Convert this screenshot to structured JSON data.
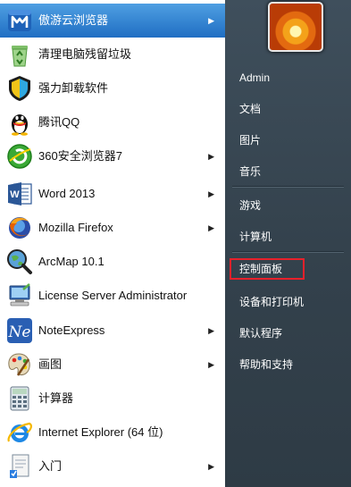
{
  "programs": [
    {
      "label": "傲游云浏览器",
      "icon": "maxthon-icon",
      "has_arrow": true,
      "selected": true
    },
    {
      "label": "清理电脑残留垃圾",
      "icon": "recycle-bin-icon",
      "has_arrow": false
    },
    {
      "label": "强力卸载软件",
      "icon": "uninstaller-icon",
      "has_arrow": false
    },
    {
      "label": "腾讯QQ",
      "icon": "qq-penguin-icon",
      "has_arrow": false
    },
    {
      "label": "360安全浏览器7",
      "icon": "360-browser-icon",
      "has_arrow": true
    },
    {
      "label": "Word 2013",
      "icon": "word-icon",
      "has_arrow": true
    },
    {
      "label": "Mozilla Firefox",
      "icon": "firefox-icon",
      "has_arrow": true
    },
    {
      "label": "ArcMap 10.1",
      "icon": "arcmap-icon",
      "has_arrow": false
    },
    {
      "label": "License Server Administrator",
      "icon": "license-server-icon",
      "has_arrow": false
    },
    {
      "label": "NoteExpress",
      "icon": "noteexpress-icon",
      "has_arrow": true
    },
    {
      "label": "画图",
      "icon": "paint-icon",
      "has_arrow": true
    },
    {
      "label": "计算器",
      "icon": "calculator-icon",
      "has_arrow": false
    },
    {
      "label": "Internet Explorer (64 位)",
      "icon": "internet-explorer-icon",
      "has_arrow": false
    },
    {
      "label": "入门",
      "icon": "getting-started-icon",
      "has_arrow": true
    }
  ],
  "right_pane": {
    "user_picture": "flower-avatar",
    "links": [
      "Admin",
      "文档",
      "图片",
      "音乐",
      "游戏",
      "计算机",
      "控制面板",
      "设备和打印机",
      "默认程序",
      "帮助和支持"
    ],
    "highlighted": "控制面板",
    "highlight_color": "#e8212b"
  },
  "colors": {
    "right_bg": "#3a4853",
    "selection": "#2f7fd3"
  }
}
